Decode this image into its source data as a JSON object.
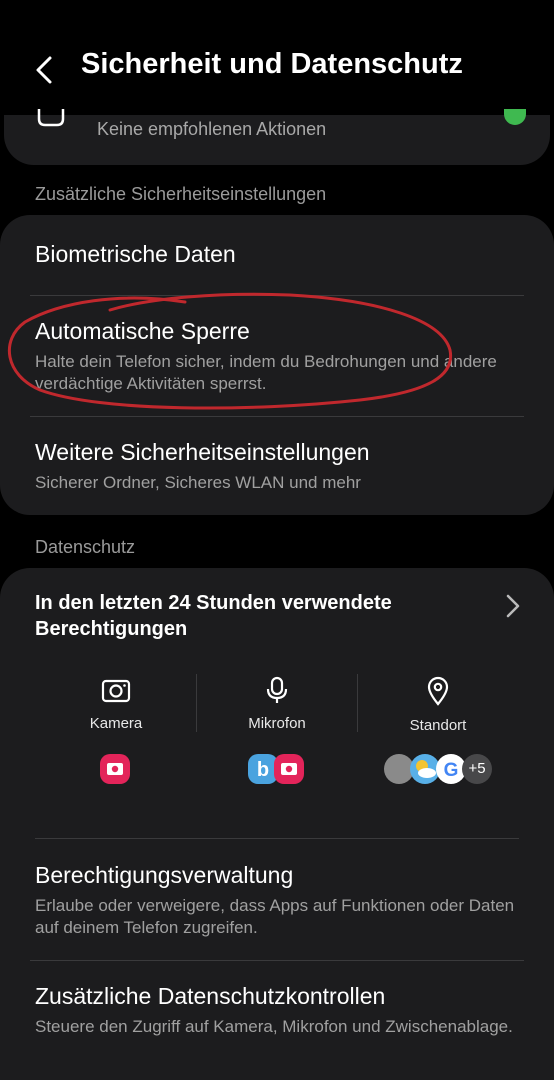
{
  "header": {
    "title": "Sicherheit und Datenschutz"
  },
  "top_card": {
    "text": "Keine empfohlenen Aktionen"
  },
  "security_section": {
    "title": "Zusätzliche Sicherheitseinstellungen",
    "items": [
      {
        "title": "Biometrische Daten",
        "subtitle": ""
      },
      {
        "title": "Automatische Sperre",
        "subtitle": "Halte dein Telefon sicher, indem du Bedrohungen und andere verdächtige Aktivitäten sperrst."
      },
      {
        "title": "Weitere Sicherheitseinstellungen",
        "subtitle": "Sicherer Ordner, Sicheres WLAN und mehr"
      }
    ]
  },
  "privacy_section": {
    "title": "Datenschutz",
    "permissions": {
      "title": "In den letzten 24 Stunden verwendete Berechtigungen",
      "columns": [
        {
          "label": "Kamera",
          "icon": "camera-icon"
        },
        {
          "label": "Mikrofon",
          "icon": "microphone-icon"
        },
        {
          "label": "Standort",
          "icon": "location-pin-icon"
        }
      ],
      "more_count": "+5"
    },
    "items": [
      {
        "title": "Berechtigungsverwaltung",
        "subtitle": "Erlaube oder verweigere, dass Apps auf Funktionen oder Daten auf deinem Telefon zugreifen."
      },
      {
        "title": "Zusätzliche Datenschutzkontrollen",
        "subtitle": "Steuere den Zugriff auf Kamera, Mikrofon und Zwischenablage."
      }
    ]
  },
  "colors": {
    "accent_green": "#3fb950",
    "app_pink": "#e3245a",
    "annotation_red": "#c0282d"
  }
}
